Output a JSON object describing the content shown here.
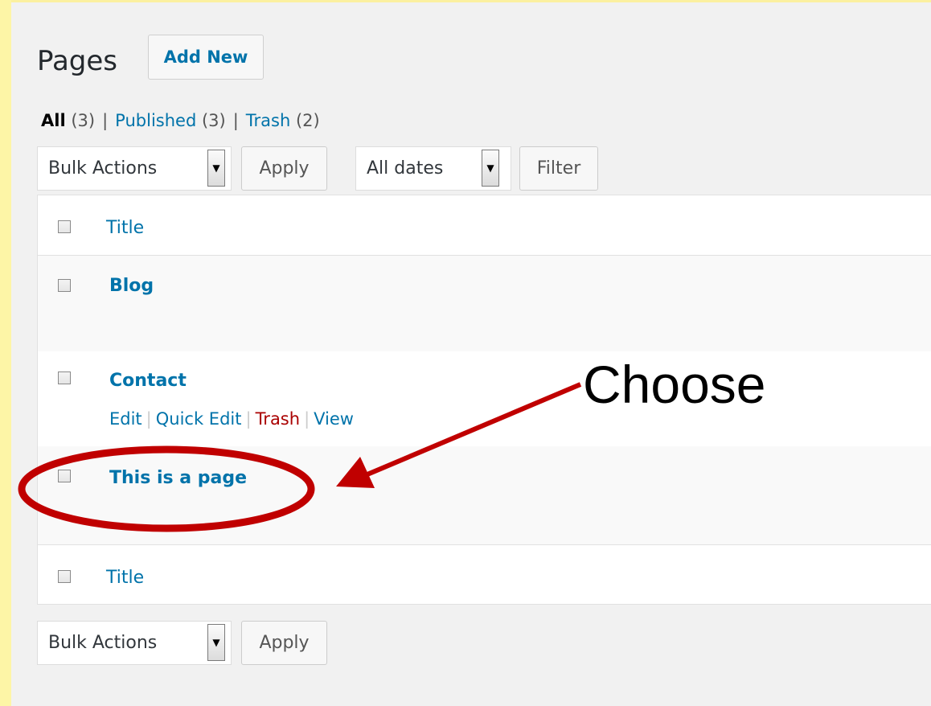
{
  "header": {
    "title": "Pages",
    "add_new_label": "Add New"
  },
  "filters": {
    "all": {
      "label": "All",
      "count": "(3)"
    },
    "published": {
      "label": "Published",
      "count": "(3)"
    },
    "trash": {
      "label": "Trash",
      "count": "(2)"
    },
    "separator": "|"
  },
  "top_nav": {
    "bulk_actions": "Bulk Actions",
    "apply_label": "Apply",
    "dates": "All dates",
    "filter_label": "Filter"
  },
  "bottom_nav": {
    "bulk_actions": "Bulk Actions",
    "apply_label": "Apply"
  },
  "table": {
    "column_title": "Title",
    "footer_title": "Title",
    "rows": [
      {
        "title": "Blog"
      },
      {
        "title": "Contact",
        "actions": {
          "edit": "Edit",
          "quick_edit": "Quick Edit",
          "trash": "Trash",
          "view": "View"
        },
        "separator": "|"
      },
      {
        "title": "This is a page"
      }
    ]
  },
  "annotation": {
    "text": "Choose",
    "color": "#c00000"
  },
  "colors": {
    "background": "#fdf5a6",
    "link": "#0073aa",
    "trash": "#aa0000"
  }
}
